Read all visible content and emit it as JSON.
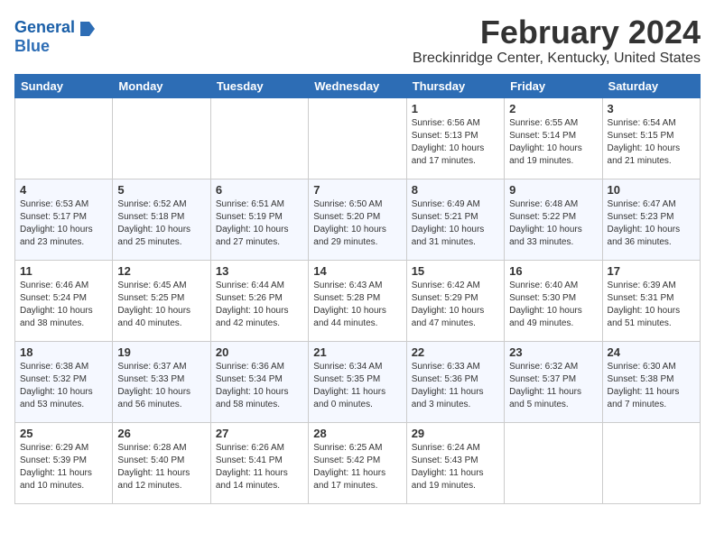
{
  "app": {
    "name": "General",
    "name2": "Blue"
  },
  "header": {
    "month_year": "February 2024",
    "location": "Breckinridge Center, Kentucky, United States"
  },
  "days_of_week": [
    "Sunday",
    "Monday",
    "Tuesday",
    "Wednesday",
    "Thursday",
    "Friday",
    "Saturday"
  ],
  "weeks": [
    [
      {
        "day": "",
        "info": ""
      },
      {
        "day": "",
        "info": ""
      },
      {
        "day": "",
        "info": ""
      },
      {
        "day": "",
        "info": ""
      },
      {
        "day": "1",
        "info": "Sunrise: 6:56 AM\nSunset: 5:13 PM\nDaylight: 10 hours\nand 17 minutes."
      },
      {
        "day": "2",
        "info": "Sunrise: 6:55 AM\nSunset: 5:14 PM\nDaylight: 10 hours\nand 19 minutes."
      },
      {
        "day": "3",
        "info": "Sunrise: 6:54 AM\nSunset: 5:15 PM\nDaylight: 10 hours\nand 21 minutes."
      }
    ],
    [
      {
        "day": "4",
        "info": "Sunrise: 6:53 AM\nSunset: 5:17 PM\nDaylight: 10 hours\nand 23 minutes."
      },
      {
        "day": "5",
        "info": "Sunrise: 6:52 AM\nSunset: 5:18 PM\nDaylight: 10 hours\nand 25 minutes."
      },
      {
        "day": "6",
        "info": "Sunrise: 6:51 AM\nSunset: 5:19 PM\nDaylight: 10 hours\nand 27 minutes."
      },
      {
        "day": "7",
        "info": "Sunrise: 6:50 AM\nSunset: 5:20 PM\nDaylight: 10 hours\nand 29 minutes."
      },
      {
        "day": "8",
        "info": "Sunrise: 6:49 AM\nSunset: 5:21 PM\nDaylight: 10 hours\nand 31 minutes."
      },
      {
        "day": "9",
        "info": "Sunrise: 6:48 AM\nSunset: 5:22 PM\nDaylight: 10 hours\nand 33 minutes."
      },
      {
        "day": "10",
        "info": "Sunrise: 6:47 AM\nSunset: 5:23 PM\nDaylight: 10 hours\nand 36 minutes."
      }
    ],
    [
      {
        "day": "11",
        "info": "Sunrise: 6:46 AM\nSunset: 5:24 PM\nDaylight: 10 hours\nand 38 minutes."
      },
      {
        "day": "12",
        "info": "Sunrise: 6:45 AM\nSunset: 5:25 PM\nDaylight: 10 hours\nand 40 minutes."
      },
      {
        "day": "13",
        "info": "Sunrise: 6:44 AM\nSunset: 5:26 PM\nDaylight: 10 hours\nand 42 minutes."
      },
      {
        "day": "14",
        "info": "Sunrise: 6:43 AM\nSunset: 5:28 PM\nDaylight: 10 hours\nand 44 minutes."
      },
      {
        "day": "15",
        "info": "Sunrise: 6:42 AM\nSunset: 5:29 PM\nDaylight: 10 hours\nand 47 minutes."
      },
      {
        "day": "16",
        "info": "Sunrise: 6:40 AM\nSunset: 5:30 PM\nDaylight: 10 hours\nand 49 minutes."
      },
      {
        "day": "17",
        "info": "Sunrise: 6:39 AM\nSunset: 5:31 PM\nDaylight: 10 hours\nand 51 minutes."
      }
    ],
    [
      {
        "day": "18",
        "info": "Sunrise: 6:38 AM\nSunset: 5:32 PM\nDaylight: 10 hours\nand 53 minutes."
      },
      {
        "day": "19",
        "info": "Sunrise: 6:37 AM\nSunset: 5:33 PM\nDaylight: 10 hours\nand 56 minutes."
      },
      {
        "day": "20",
        "info": "Sunrise: 6:36 AM\nSunset: 5:34 PM\nDaylight: 10 hours\nand 58 minutes."
      },
      {
        "day": "21",
        "info": "Sunrise: 6:34 AM\nSunset: 5:35 PM\nDaylight: 11 hours\nand 0 minutes."
      },
      {
        "day": "22",
        "info": "Sunrise: 6:33 AM\nSunset: 5:36 PM\nDaylight: 11 hours\nand 3 minutes."
      },
      {
        "day": "23",
        "info": "Sunrise: 6:32 AM\nSunset: 5:37 PM\nDaylight: 11 hours\nand 5 minutes."
      },
      {
        "day": "24",
        "info": "Sunrise: 6:30 AM\nSunset: 5:38 PM\nDaylight: 11 hours\nand 7 minutes."
      }
    ],
    [
      {
        "day": "25",
        "info": "Sunrise: 6:29 AM\nSunset: 5:39 PM\nDaylight: 11 hours\nand 10 minutes."
      },
      {
        "day": "26",
        "info": "Sunrise: 6:28 AM\nSunset: 5:40 PM\nDaylight: 11 hours\nand 12 minutes."
      },
      {
        "day": "27",
        "info": "Sunrise: 6:26 AM\nSunset: 5:41 PM\nDaylight: 11 hours\nand 14 minutes."
      },
      {
        "day": "28",
        "info": "Sunrise: 6:25 AM\nSunset: 5:42 PM\nDaylight: 11 hours\nand 17 minutes."
      },
      {
        "day": "29",
        "info": "Sunrise: 6:24 AM\nSunset: 5:43 PM\nDaylight: 11 hours\nand 19 minutes."
      },
      {
        "day": "",
        "info": ""
      },
      {
        "day": "",
        "info": ""
      }
    ]
  ]
}
